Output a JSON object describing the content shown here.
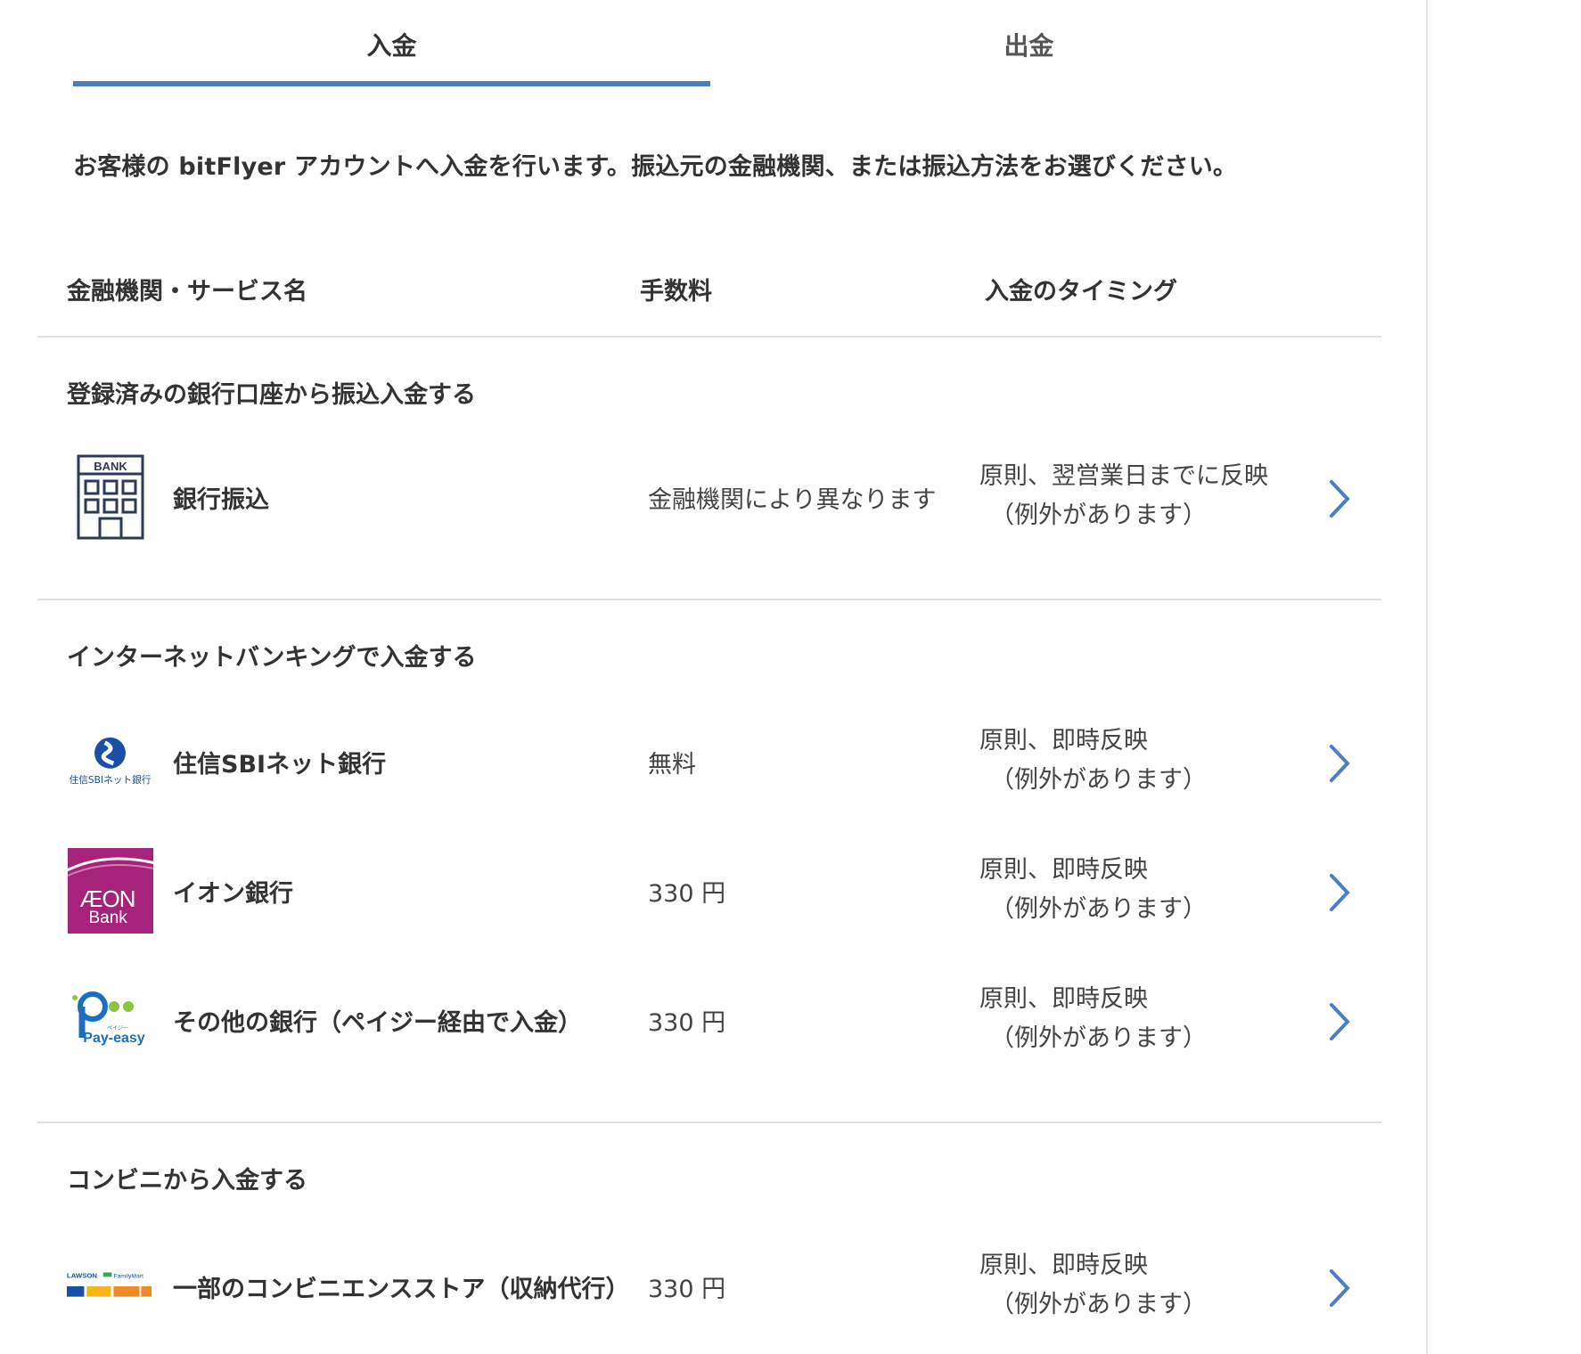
{
  "tabs": [
    {
      "label": "入金",
      "active": true
    },
    {
      "label": "出金",
      "active": false
    }
  ],
  "intro_text": "お客様の bitFlyer アカウントへ入金を行います。振込元の金融機関、または振込方法をお選びください。",
  "table_header": {
    "name": "金融機関・サービス名",
    "fee": "手数料",
    "timing": "入金のタイミング"
  },
  "sections": [
    {
      "title": "登録済みの銀行口座から振込入金する",
      "rows": [
        {
          "logo": "bank-building-icon",
          "logo_text": "BANK",
          "name": "銀行振込",
          "fee": "金融機関により異なります",
          "timing_line1": "原則、翌営業日までに反映",
          "timing_line2": "（例外があります）"
        }
      ]
    },
    {
      "title": "インターネットバンキングで入金する",
      "rows": [
        {
          "logo": "sbi-logo",
          "logo_text": "住信SBIネット銀行",
          "name": "住信SBIネット銀行",
          "fee": "無料",
          "timing_line1": "原則、即時反映",
          "timing_line2": "（例外があります）"
        },
        {
          "logo": "aeon-bank-logo",
          "logo_text": "ÆON",
          "logo_subtext": "Bank",
          "name": "イオン銀行",
          "fee": "330 円",
          "timing_line1": "原則、即時反映",
          "timing_line2": "（例外があります）"
        },
        {
          "logo": "pay-easy-logo",
          "logo_text": "Pay-easy",
          "logo_subtext": "ペイジー",
          "name": "その他の銀行（ペイジー経由で入金）",
          "fee": "330 円",
          "timing_line1": "原則、即時反映",
          "timing_line2": "（例外があります）"
        }
      ]
    },
    {
      "title": "コンビニから入金する",
      "rows": [
        {
          "logo": "convenience-store-logo",
          "logo_text": "LAWSON",
          "logo_text2": "FamilyMart",
          "name": "一部のコンビニエンスストア（収納代行）",
          "fee": "330 円",
          "timing_line1": "原則、即時反映",
          "timing_line2": "（例外があります）"
        }
      ]
    }
  ],
  "colors": {
    "accent": "#4a7fc1",
    "aeon": "#a6237b",
    "text": "#333333",
    "divider": "#e0e0e0"
  }
}
